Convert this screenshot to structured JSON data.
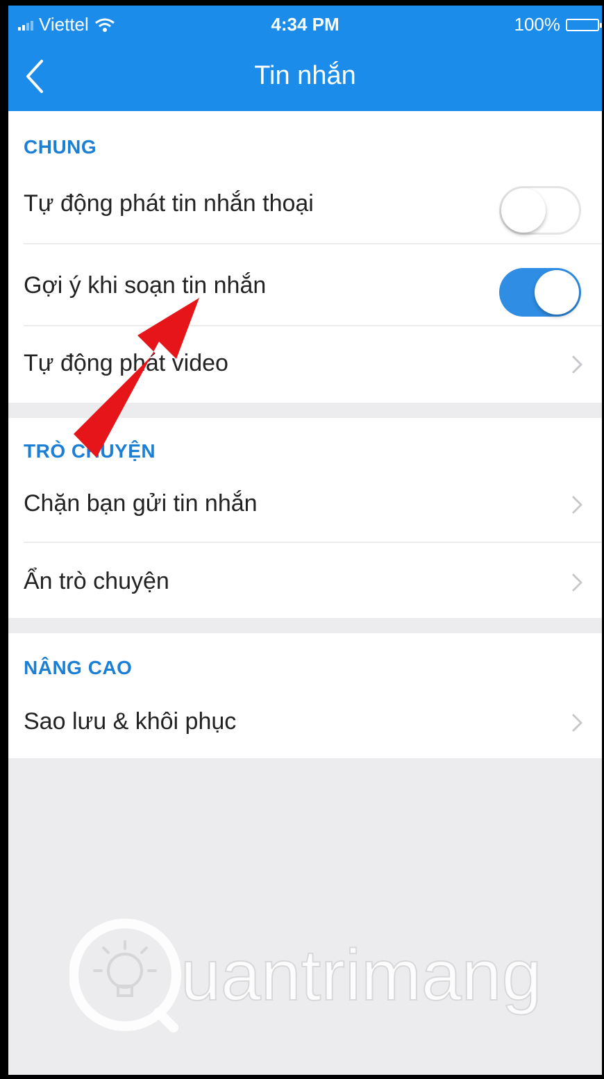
{
  "status_bar": {
    "carrier": "Viettel",
    "time": "4:34 PM",
    "battery": "100%"
  },
  "nav": {
    "title": "Tin nhắn",
    "back_icon": "chevron-left-icon"
  },
  "sections": {
    "chung": {
      "header": "CHUNG",
      "rows": [
        {
          "label": "Tự động phát tin nhắn thoại",
          "control": "toggle",
          "toggle_on": false
        },
        {
          "label": "Gợi ý khi soạn tin nhắn",
          "control": "toggle",
          "toggle_on": true
        },
        {
          "label": "Tự động phát video",
          "control": "chevron"
        }
      ]
    },
    "tro_chuyen": {
      "header": "TRÒ CHUYỆN",
      "rows": [
        {
          "label": "Chặn bạn gửi tin nhắn",
          "control": "chevron"
        },
        {
          "label": "Ẩn trò chuyện",
          "control": "chevron"
        }
      ]
    },
    "nang_cao": {
      "header": "NÂNG CAO",
      "rows": [
        {
          "label": "Sao lưu & khôi phục",
          "control": "chevron"
        }
      ]
    }
  },
  "watermark": {
    "text": "Quantrimang"
  },
  "colors": {
    "accent": "#1b8cea",
    "section_header": "#1b7fd6",
    "toggle_on": "#2f8de4",
    "background": "#ececee",
    "annotation_arrow": "#e5151a"
  }
}
